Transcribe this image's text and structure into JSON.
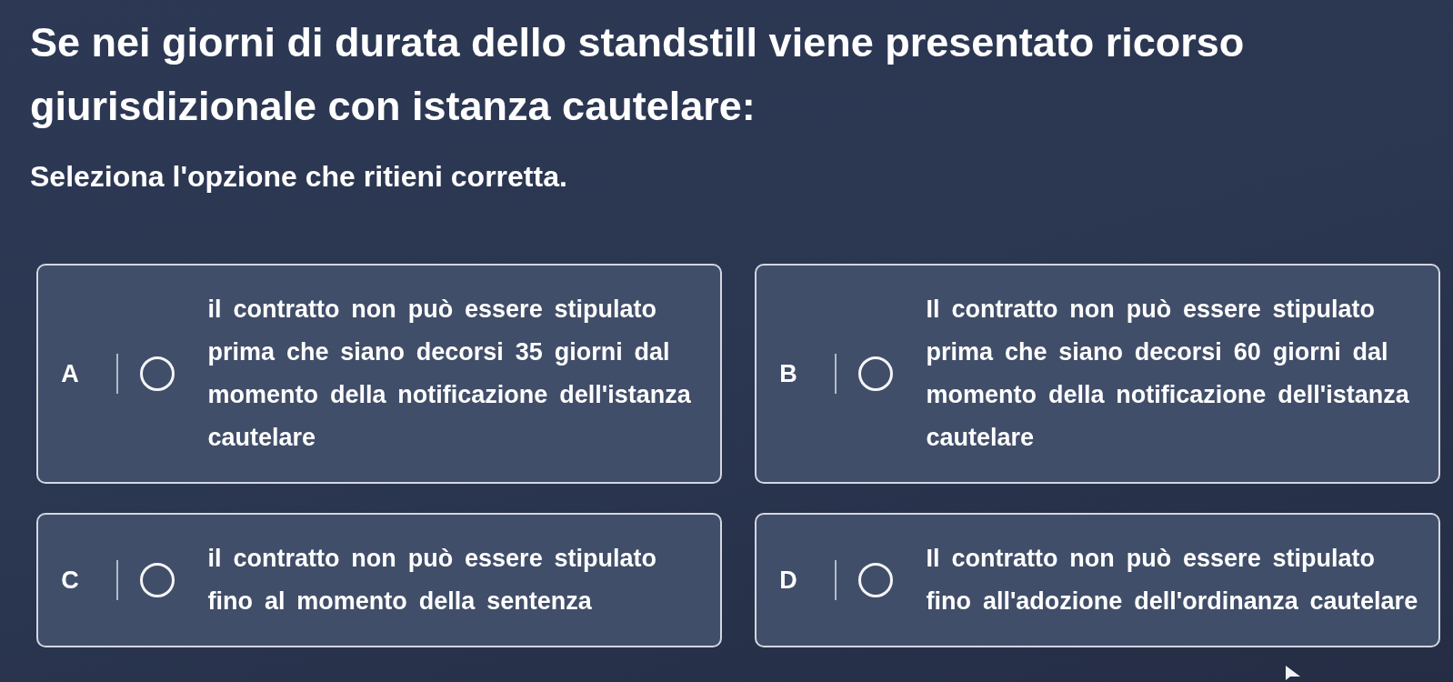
{
  "question": {
    "title": "Se nei giorni di durata dello standstill viene presentato ricorso giurisdizionale con istanza cautelare:",
    "instruction": "Seleziona l'opzione che ritieni corretta."
  },
  "options": [
    {
      "letter": "A",
      "text": "il contratto non può essere stipulato prima che siano decorsi 35 giorni dal momento della notificazione dell'istanza cautelare",
      "selected": false
    },
    {
      "letter": "B",
      "text": "Il contratto non può essere stipulato prima che siano decorsi 60 giorni dal momento della notificazione dell'istanza cautelare",
      "selected": false
    },
    {
      "letter": "C",
      "text": "il contratto non può essere stipulato fino al momento della sentenza",
      "selected": false
    },
    {
      "letter": "D",
      "text": "Il contratto non può essere stipulato fino all'adozione dell'ordinanza cautelare",
      "selected": false
    }
  ]
}
